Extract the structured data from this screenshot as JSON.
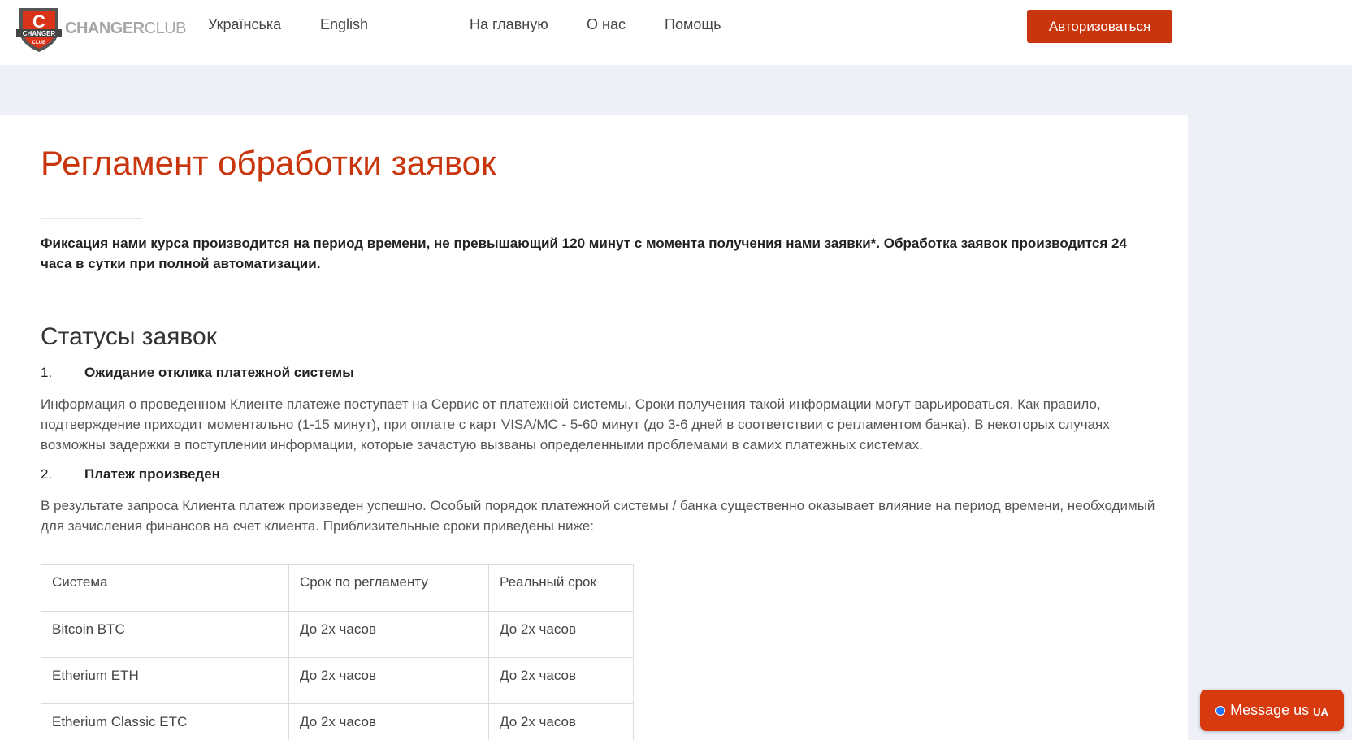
{
  "header": {
    "logo": {
      "shield_letter": "C",
      "shield_ribbon": "CHANGER",
      "shield_sub": "CLUB",
      "text_main": "CHANGER",
      "text_club": "CLUB"
    },
    "lang_links": [
      "Українська",
      "English"
    ],
    "nav_links": [
      "На главную",
      "О нас",
      "Помощь"
    ],
    "auth_button": "Авторизоваться",
    "accent_color": "#c9350c"
  },
  "main": {
    "title": "Регламент обработки заявок",
    "lead": "Фиксация нами курса производится на период времени, не превышающий 120 минут с момента получения нами заявки*. Обработка заявок производится 24 часа в сутки при полной автоматизации.",
    "section_title": "Статусы заявок",
    "statuses": [
      {
        "num": "1.",
        "label": "Ожидание отклика платежной системы",
        "text": "Информация о проведенном Клиенте платеже поступает на Сервис от платежной системы. Сроки получения такой информации могут варьироваться. Как правило, подтверждение приходит моментально (1-15 минут), при оплате с карт VISA/MC - 5-60 минут (до 3-6 дней в соответствии с регламентом банка). В некоторых случаях возможны задержки в поступлении информации, которые зачастую вызваны определенными проблемами в самих платежных системах."
      },
      {
        "num": "2.",
        "label": "Платеж произведен",
        "text": "В результате запроса Клиента платеж произведен успешно. Особый порядок платежной системы / банка существенно оказывает влияние на период времени, необходимый для зачисления финансов на счет клиента. Приблизительные сроки приведены ниже:"
      }
    ],
    "table": {
      "headers": [
        "Система",
        "Срок по регламенту",
        "Реальный срок"
      ],
      "rows": [
        [
          "Bitcoin BTC",
          "До 2х часов",
          "До 2х часов"
        ],
        [
          "Etherium ETH",
          "До 2х часов",
          "До 2х часов"
        ],
        [
          "Etherium Classic ETC",
          "До 2х часов",
          "До 2х часов"
        ]
      ]
    }
  },
  "chat": {
    "label": "Message us",
    "lang": "UA",
    "status_color": "#1e73ff"
  }
}
